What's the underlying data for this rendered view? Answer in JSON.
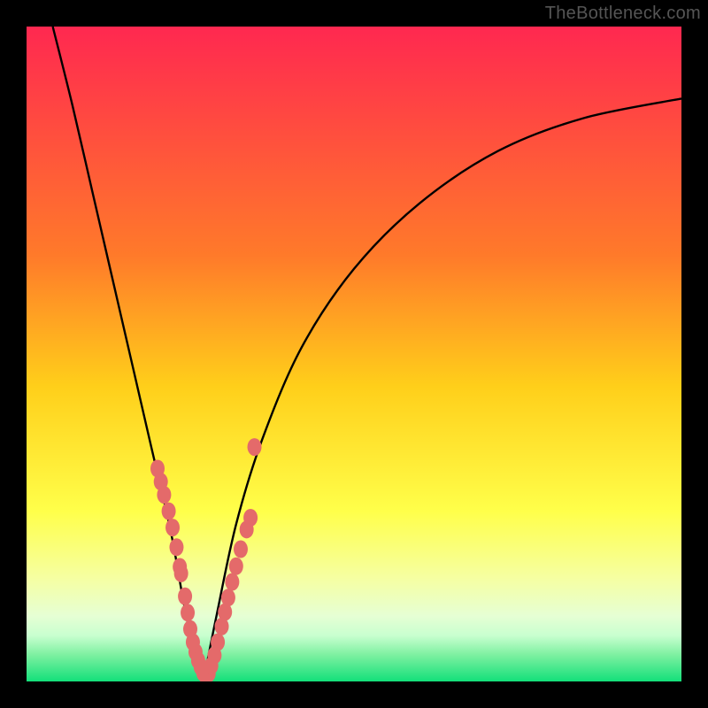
{
  "watermark": "TheBottleneck.com",
  "chart_data": {
    "type": "line",
    "title": "",
    "xlabel": "",
    "ylabel": "",
    "xlim": [
      0,
      100
    ],
    "ylim": [
      0,
      100
    ],
    "grid": false,
    "legend": false,
    "gradient_stops": [
      {
        "offset": 0,
        "color": "#ff2850"
      },
      {
        "offset": 0.35,
        "color": "#ff7a2a"
      },
      {
        "offset": 0.55,
        "color": "#ffcf1a"
      },
      {
        "offset": 0.74,
        "color": "#ffff4a"
      },
      {
        "offset": 0.84,
        "color": "#f6ffa0"
      },
      {
        "offset": 0.9,
        "color": "#e6ffd4"
      },
      {
        "offset": 0.93,
        "color": "#c8ffcf"
      },
      {
        "offset": 0.96,
        "color": "#7cf0a0"
      },
      {
        "offset": 1.0,
        "color": "#13e07a"
      }
    ],
    "series": [
      {
        "name": "left-curve",
        "color": "#000000",
        "x": [
          4.0,
          7.0,
          10.0,
          13.0,
          16.0,
          19.0,
          22.0,
          24.0,
          25.5,
          27.0
        ],
        "values": [
          100,
          88,
          75,
          62,
          49,
          36,
          23,
          12,
          5,
          0
        ]
      },
      {
        "name": "right-curve",
        "color": "#000000",
        "x": [
          27.0,
          29.0,
          32.0,
          36.0,
          42.0,
          50.0,
          60.0,
          72.0,
          85.0,
          100.0
        ],
        "values": [
          0,
          10,
          24,
          37,
          51,
          63,
          73,
          81,
          86,
          89
        ]
      }
    ],
    "left_markers": {
      "name": "left-markers",
      "color": "#e46a6a",
      "x": [
        20.0,
        20.5,
        21.0,
        21.7,
        22.3,
        22.9,
        23.4,
        23.6,
        24.2,
        24.6,
        25.0,
        25.4,
        25.8,
        26.2,
        26.6,
        27.0,
        27.4
      ],
      "values": [
        32.5,
        30.5,
        28.5,
        26.0,
        23.5,
        20.5,
        17.5,
        16.5,
        13.0,
        10.5,
        8.0,
        6.0,
        4.5,
        3.2,
        2.2,
        1.3,
        0.8
      ]
    },
    "right_markers": {
      "name": "right-markers",
      "color": "#e46a6a",
      "x": [
        27.8,
        28.2,
        28.7,
        29.2,
        29.8,
        30.3,
        30.8,
        31.4,
        32.0,
        32.7,
        33.6,
        34.2,
        34.8
      ],
      "values": [
        1.2,
        2.4,
        4.0,
        6.0,
        8.4,
        10.6,
        12.8,
        15.2,
        17.6,
        20.2,
        23.2,
        25.0,
        35.8
      ]
    }
  }
}
